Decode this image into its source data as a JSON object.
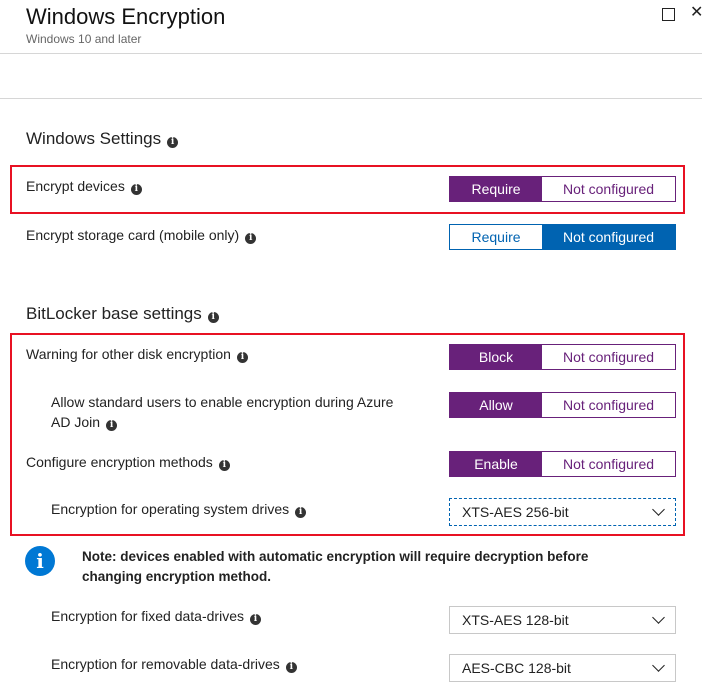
{
  "header": {
    "title": "Windows Encryption",
    "subtitle": "Windows 10 and later",
    "maximize_icon": "maximize-icon",
    "close_icon": "close-icon"
  },
  "sections": {
    "windows_settings": {
      "heading": "Windows Settings",
      "encrypt_devices": {
        "label": "Encrypt devices",
        "options": [
          "Require",
          "Not configured"
        ],
        "selected": "Require"
      },
      "encrypt_storage_card": {
        "label": "Encrypt storage card (mobile only)",
        "options": [
          "Require",
          "Not configured"
        ],
        "selected": "Not configured"
      }
    },
    "bitlocker": {
      "heading": "BitLocker base settings",
      "warning_other_disk": {
        "label": "Warning for other disk encryption",
        "options": [
          "Block",
          "Not configured"
        ],
        "selected": "Block"
      },
      "allow_standard_users": {
        "label_line1": "Allow standard users to enable encryption during Azure",
        "label_line2": "AD Join",
        "options": [
          "Allow",
          "Not configured"
        ],
        "selected": "Allow"
      },
      "configure_methods": {
        "label": "Configure encryption methods",
        "options": [
          "Enable",
          "Not configured"
        ],
        "selected": "Enable"
      },
      "os_drives": {
        "label": "Encryption for operating system drives",
        "value": "XTS-AES 256-bit"
      },
      "note": {
        "line1": "Note: devices enabled with automatic encryption will require decryption before",
        "line2": "changing encryption method."
      },
      "fixed_drives": {
        "label": "Encryption for fixed data-drives",
        "value": "XTS-AES 128-bit"
      },
      "removable_drives": {
        "label": "Encryption for removable data-drives",
        "value": "AES-CBC 128-bit"
      }
    }
  },
  "colors": {
    "purple_accent": "#68217a",
    "blue_accent": "#0063b1",
    "highlight_red": "#e81123",
    "info_blue": "#0078d4"
  }
}
